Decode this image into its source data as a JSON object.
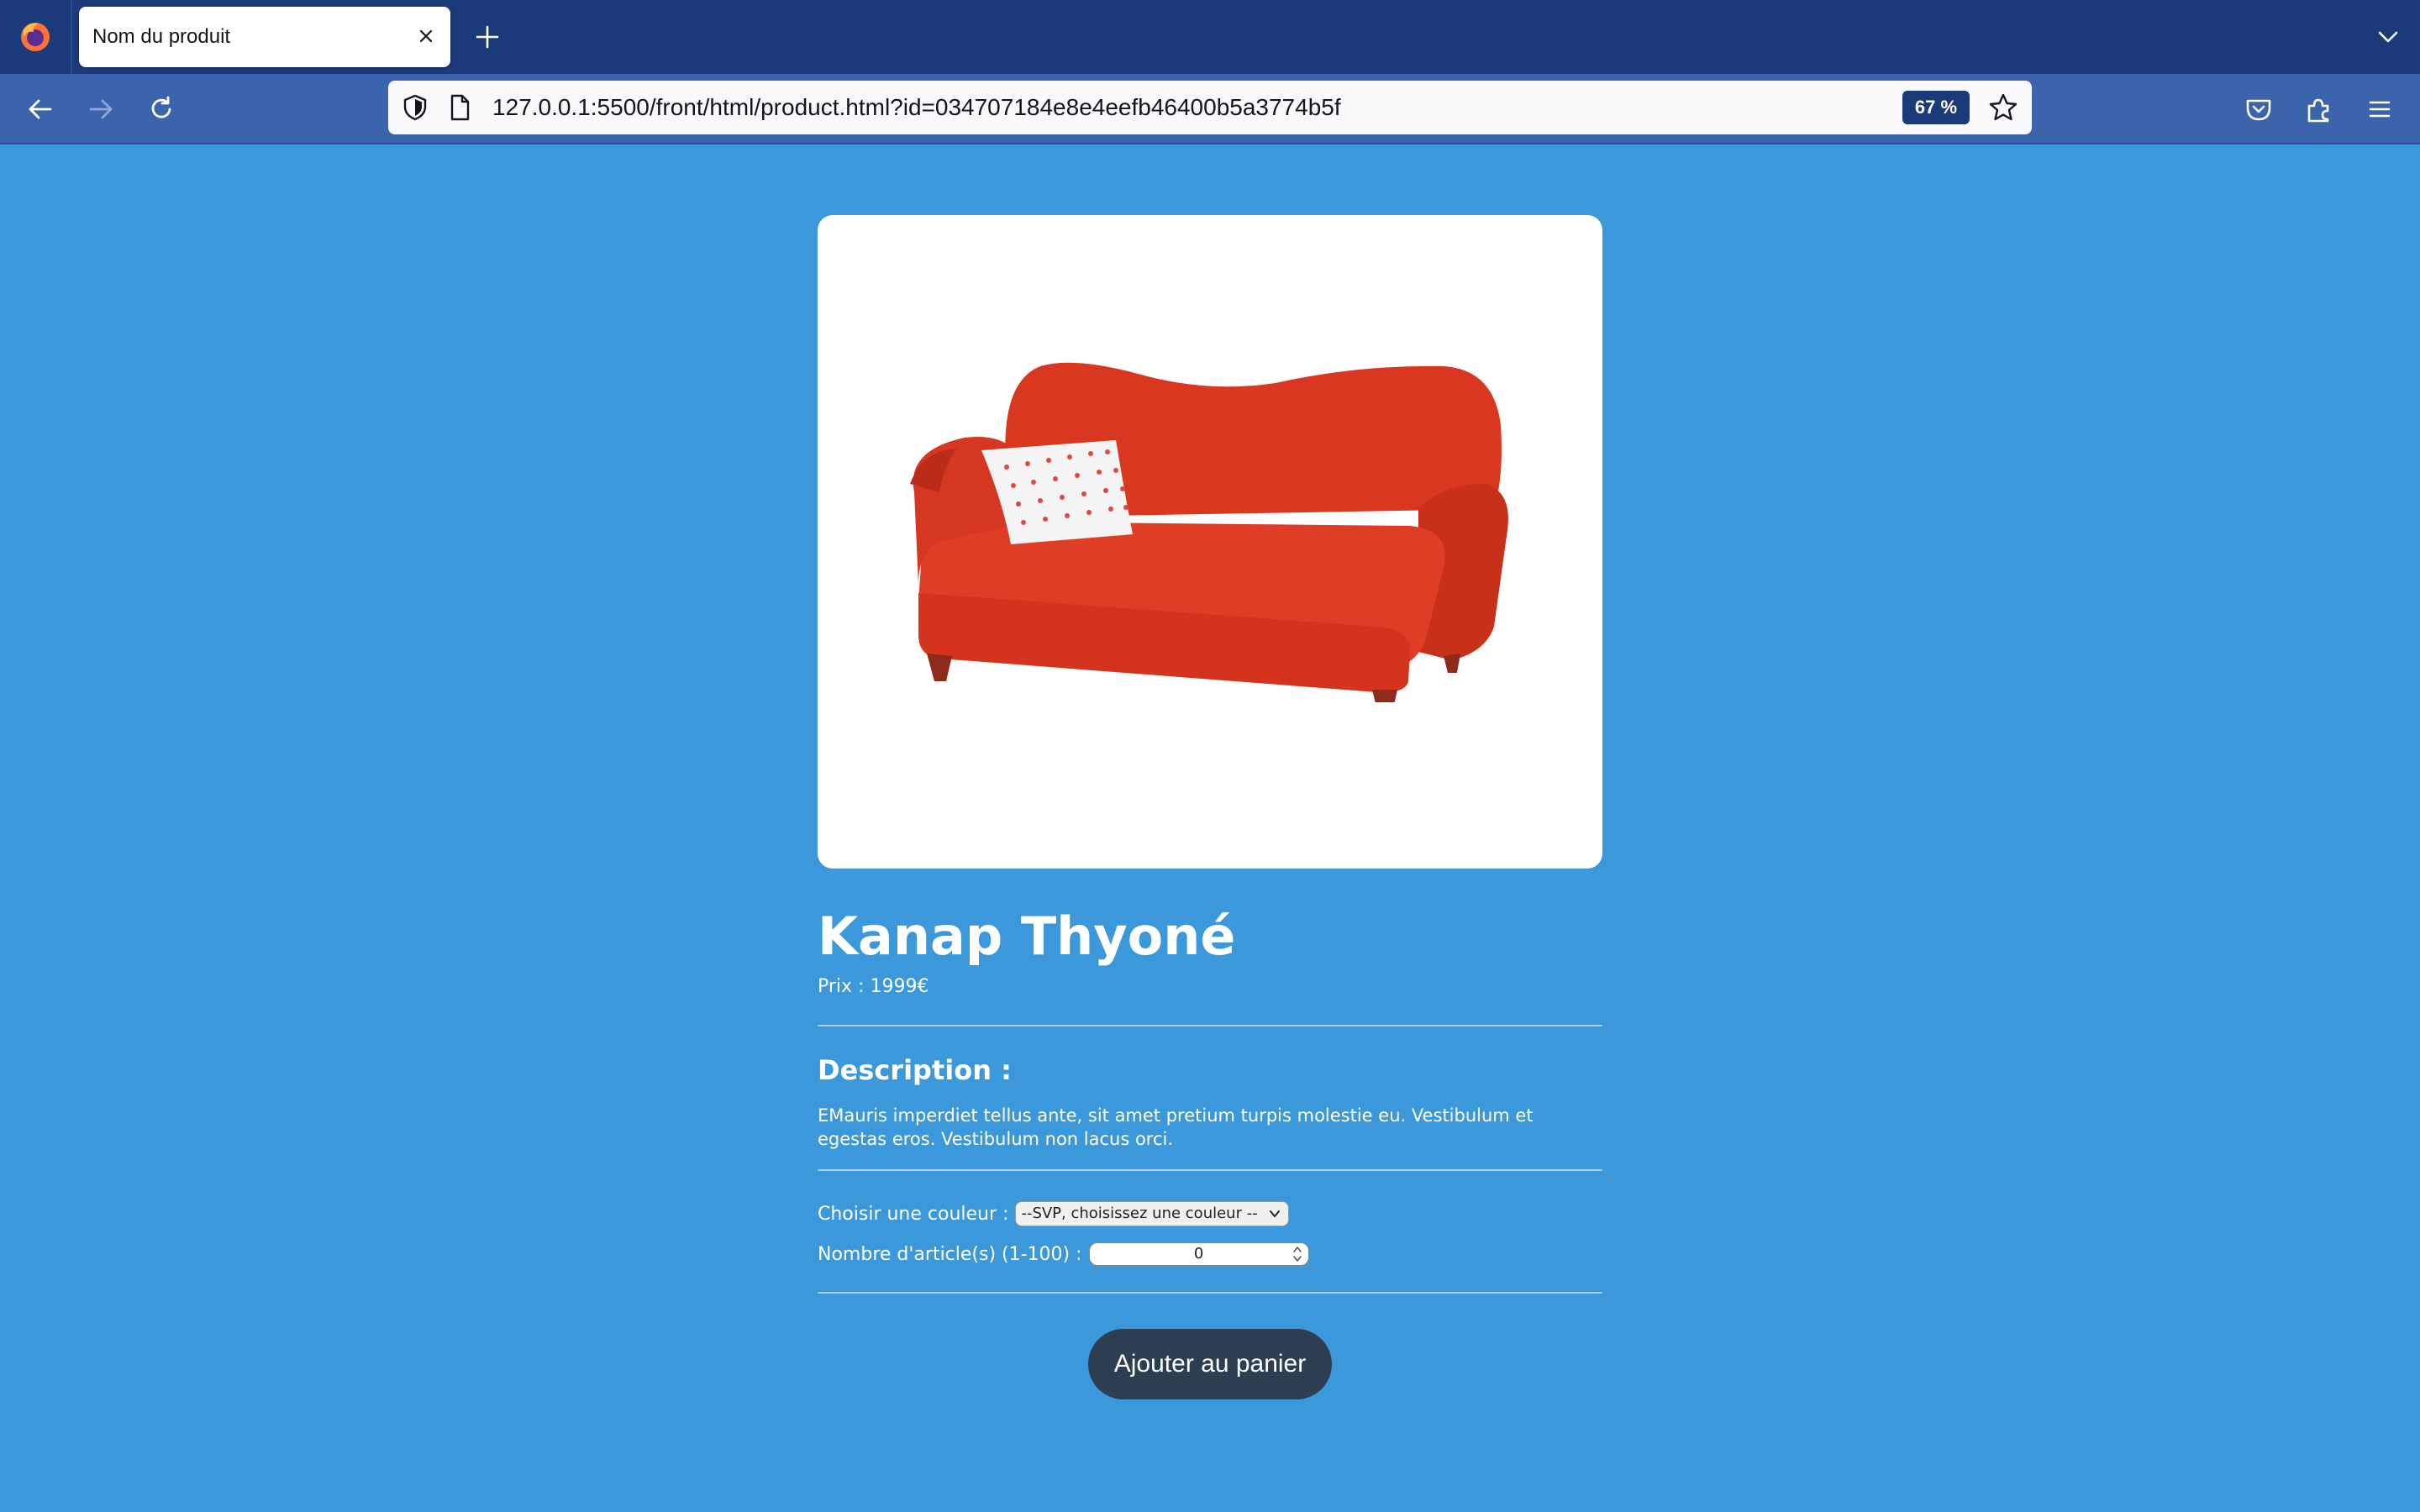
{
  "browser": {
    "tab_title": "Nom du produit",
    "url_host": "127.0.0.1",
    "url_rest": ":5500/front/html/product.html?id=034707184e8e4eefb46400b5a3774b5f",
    "zoom": "67 %",
    "icons": [
      "firefox-icon",
      "close-icon",
      "plus-icon",
      "chevron-down-icon",
      "back-arrow-icon",
      "forward-arrow-icon",
      "reload-icon",
      "shield-icon",
      "page-icon",
      "star-icon",
      "pocket-icon",
      "extensions-icon",
      "menu-icon"
    ]
  },
  "product": {
    "name": "Kanap Thyoné",
    "price_label": "Prix : 1999€",
    "description_title": "Description :",
    "description": "EMauris imperdiet tellus ante, sit amet pretium turpis molestie eu. Vestibulum et egestas eros. Vestibulum non lacus orci.",
    "color_label": "Choisir une couleur :",
    "color_select_value": "--SVP, choisissez une couleur --",
    "qty_label": "Nombre d'article(s) (1-100) :",
    "qty_value": "0",
    "add_button": "Ajouter au panier",
    "image": "red-sofa-with-pillow"
  },
  "colors": {
    "page_bg": "#3b98da",
    "tabbar_bg": "#1b3a7a",
    "navbar_bg": "#3c64ad",
    "button_bg": "#2c3e50",
    "sofa": "#db3b25"
  }
}
